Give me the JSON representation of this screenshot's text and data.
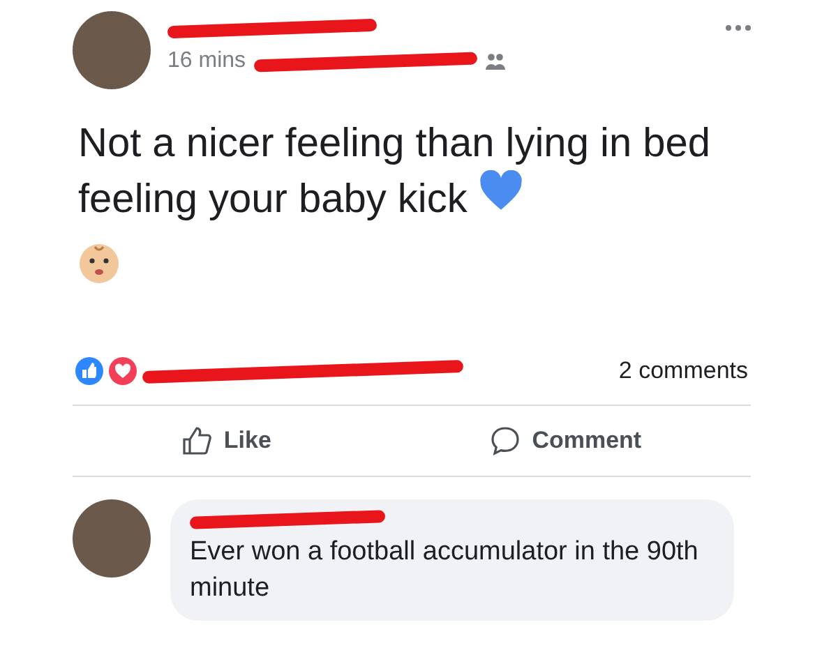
{
  "post": {
    "time": "16 mins",
    "text": "Not a nicer feeling than lying in bed feeling your baby kick",
    "comments_count": "2 comments"
  },
  "actions": [
    {
      "kind": "like",
      "label": "Like"
    },
    {
      "kind": "comment",
      "label": "Comment"
    }
  ],
  "comment": {
    "text": "Ever won a football accumulator in the 90th minute"
  }
}
